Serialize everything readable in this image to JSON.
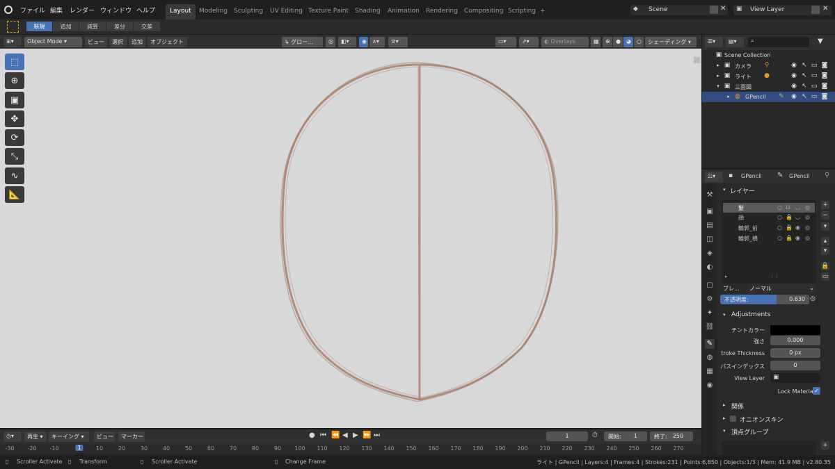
{
  "topbar": {
    "menus": [
      "ファイル",
      "編集",
      "レンダー",
      "ウィンドウ",
      "ヘルプ"
    ],
    "workspaces": [
      "Layout",
      "Modeling",
      "Sculpting",
      "UV Editing",
      "Texture Paint",
      "Shading",
      "Animation",
      "Rendering",
      "Compositing",
      "Scripting"
    ],
    "add_tab": "+",
    "scene": "Scene",
    "view_layer": "View Layer"
  },
  "tool_header": {
    "modes": [
      "新規",
      "追加",
      "減算",
      "差分",
      "交差"
    ]
  },
  "view_header": {
    "mode": "Object Mode",
    "menus": [
      "ビュー",
      "選択",
      "追加",
      "オブジェクト"
    ],
    "orientation": "グロー...",
    "overlays": "Overlays",
    "shading": "シェーディング"
  },
  "toolbar": {
    "tools": [
      "select-box",
      "cursor",
      "transform",
      "move",
      "rotate",
      "scale",
      "annotate",
      "measure"
    ]
  },
  "timeline": {
    "menus": [
      "再生",
      "キーイング",
      "ビュー",
      "マーカー"
    ],
    "current_frame": "1",
    "start_label": "開始:",
    "start": "1",
    "end_label": "終了:",
    "end": "250",
    "ticks": [
      "-30",
      "-20",
      "-10",
      "1",
      "10",
      "20",
      "30",
      "40",
      "50",
      "60",
      "70",
      "80",
      "90",
      "100",
      "110",
      "120",
      "130",
      "140",
      "150",
      "160",
      "170",
      "180",
      "190",
      "200",
      "210",
      "220",
      "230",
      "240",
      "250",
      "260",
      "270"
    ]
  },
  "statusbar": {
    "left1": "Scroller Activate",
    "left2": "Transform",
    "left3": "Scroller Activate",
    "left4": "Change Frame",
    "info": "ライト | GPencil | Layers:4 | Frames:4 | Strokes:231 | Points:6,850 | Objects:1/3 | Mem: 41.9 MB | v2.80.35"
  },
  "outliner": {
    "root": "Scene Collection",
    "items": [
      {
        "name": "カメラ"
      },
      {
        "name": "ライト"
      },
      {
        "name": "三面図"
      },
      {
        "name": "GPencil",
        "selected": true
      }
    ]
  },
  "properties": {
    "object_name": "GPencil",
    "data_name": "GPencil",
    "layers_title": "レイヤー",
    "layers": [
      "髪",
      "顔",
      "輪郭_前",
      "輪郭_横"
    ],
    "blend_label": "ブレ...",
    "blend_value": "ノーマル",
    "opacity_label": "不透明度:",
    "opacity_value": "0.630",
    "opacity_fraction": 0.63,
    "adjustments_title": "Adjustments",
    "tint_color_label": "チントカラー",
    "tint_color": "#000000",
    "strength_label": "強さ",
    "strength_value": "0.000",
    "stroke_thickness_label": "troke Thickness",
    "stroke_thickness_value": "0 px",
    "pass_index_label": "パスインデックス",
    "pass_index_value": "0",
    "view_layer_label": "View Layer",
    "lock_material_label": "Lock Material",
    "relations_title": "関係",
    "onion_title": "オニオンスキン",
    "vertex_groups_title": "頂点グループ"
  },
  "colors": {
    "accent": "#4772b3",
    "viewport_bg": "#d8d8d8",
    "stroke": "#a57b63",
    "selection": "#334d80"
  }
}
